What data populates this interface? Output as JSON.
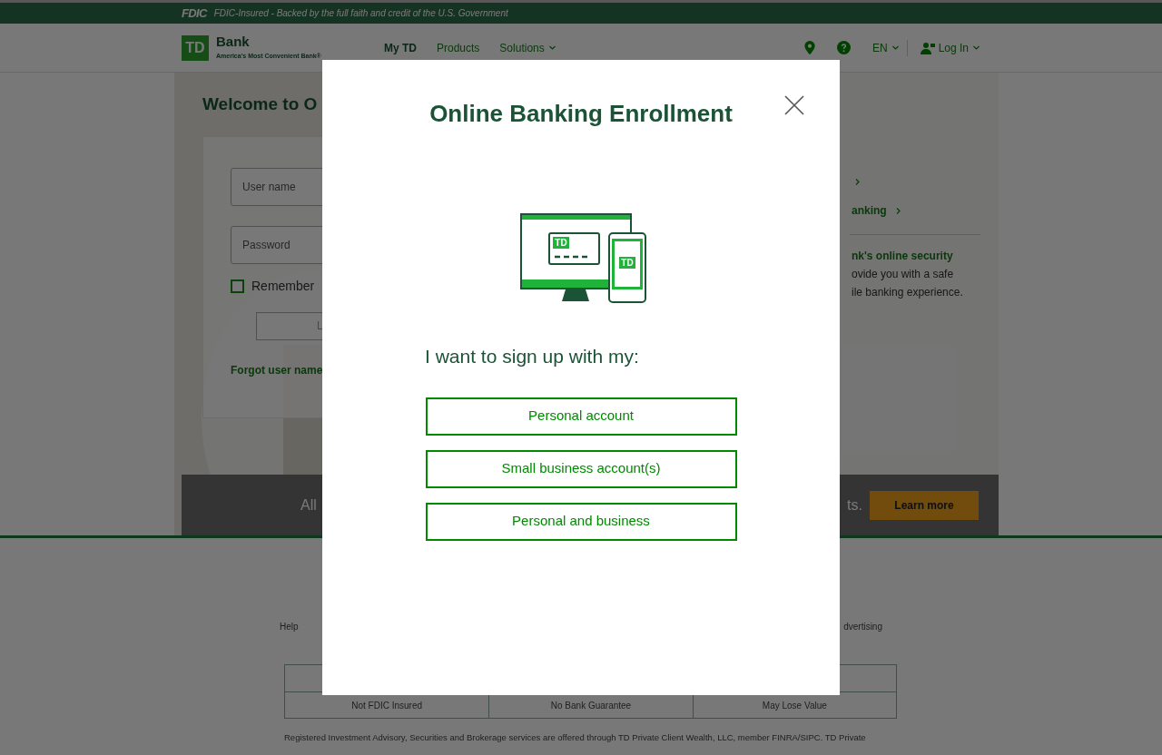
{
  "fdic_bar": {
    "logo": "FDIC",
    "text": "FDIC-Insured - Backed by the full faith and credit of the U.S. Government"
  },
  "header": {
    "logo": "TD",
    "brand": "Bank",
    "tagline": "America's Most Convenient Bank®",
    "nav": [
      {
        "label": "My TD",
        "selected": true,
        "has_menu": false
      },
      {
        "label": "Products",
        "selected": false,
        "has_menu": false
      },
      {
        "label": "Solutions",
        "selected": false,
        "has_menu": true
      }
    ],
    "language": "EN",
    "login": "Log In"
  },
  "login": {
    "title": "Welcome to O",
    "username_placeholder": "User name",
    "password_placeholder": "Password",
    "remember": "Remember",
    "remember_checked": false,
    "button": "L",
    "forgot": "Forgot user name"
  },
  "side": {
    "links": [
      {
        "text": "anking"
      }
    ],
    "security_title": "nk's online security",
    "security_lines": [
      "ovide you with a safe",
      "ile banking experience."
    ]
  },
  "banner": {
    "left": "All",
    "right": "ts.",
    "button": "Learn more"
  },
  "footer": {
    "links": [
      "Help",
      "dvertising"
    ],
    "table_row": [
      "Not FDIC Insured",
      "No Bank Guarantee",
      "May Lose Value"
    ],
    "disclaimer": [
      "Registered Investment Advisory, Securities and Brokerage services are offered through TD Private Client Wealth, LLC, member FINRA/SIPC. TD Private"
    ]
  },
  "modal": {
    "title": "Online Banking Enrollment",
    "prompt": "I want to sign up with my:",
    "options": [
      {
        "label": "Personal account"
      },
      {
        "label": "Small business account(s)"
      },
      {
        "label": "Personal and business"
      }
    ],
    "illustration_marks": [
      "TD",
      "TD"
    ]
  }
}
